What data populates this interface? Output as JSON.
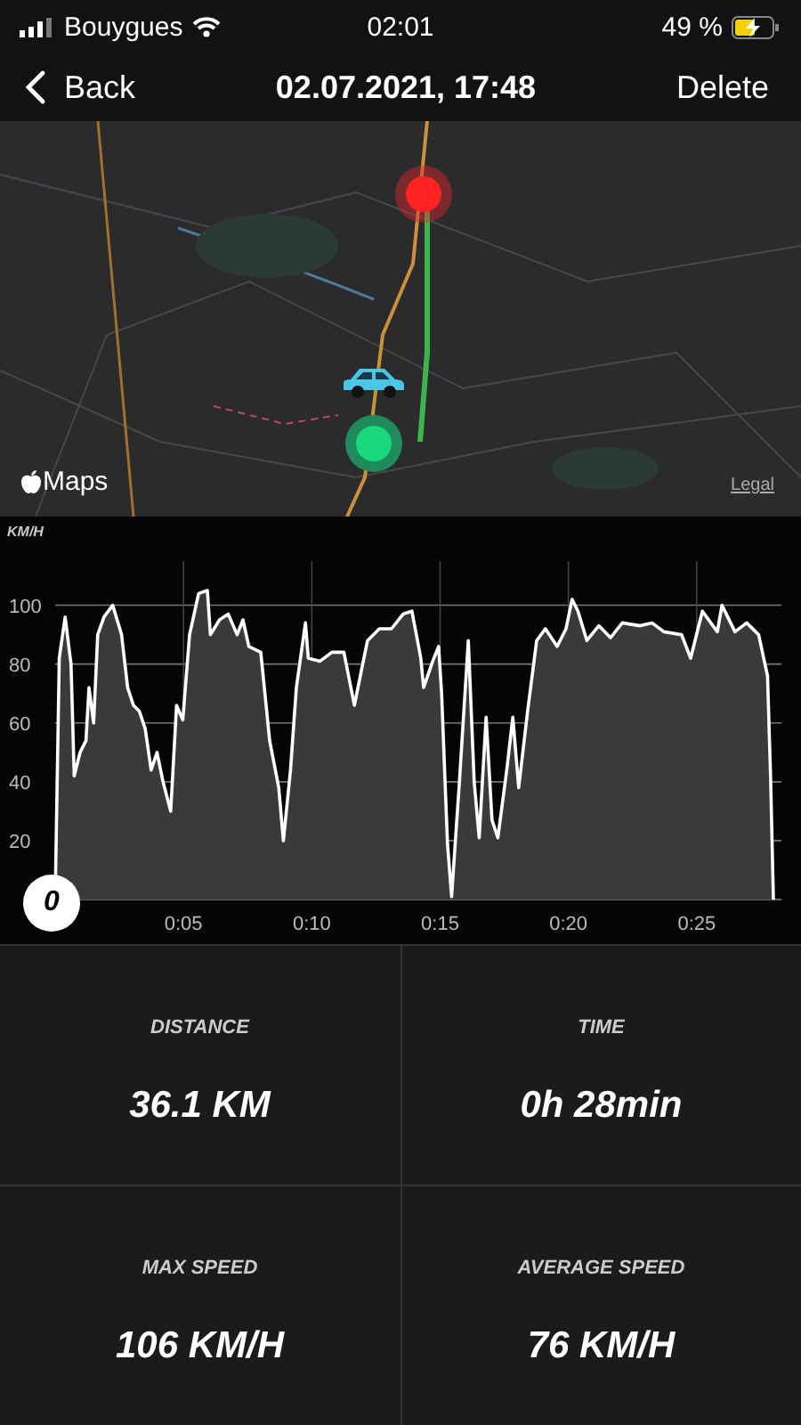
{
  "status_bar": {
    "carrier": "Bouygues",
    "time": "02:01",
    "battery": "49 %"
  },
  "nav": {
    "back": "Back",
    "title": "02.07.2021, 17:48",
    "action": "Delete"
  },
  "map": {
    "logo": "Maps",
    "legal": "Legal"
  },
  "speed_chart": {
    "zero_label": "0",
    "chart_data": {
      "type": "area",
      "ylabel": "KM/H",
      "grid": true,
      "xlim": [
        0,
        28.3
      ],
      "ylim": [
        0,
        115
      ],
      "xticks": [
        {
          "value": 5,
          "label": "0:05"
        },
        {
          "value": 10,
          "label": "0:10"
        },
        {
          "value": 15,
          "label": "0:15"
        },
        {
          "value": 20,
          "label": "0:20"
        },
        {
          "value": 25,
          "label": "0:25"
        }
      ],
      "yticks": [
        20,
        40,
        60,
        80,
        100
      ],
      "x": [
        0,
        0.16,
        0.39,
        0.62,
        0.74,
        0.97,
        1.2,
        1.32,
        1.5,
        1.66,
        1.9,
        2.24,
        2.59,
        2.82,
        3.05,
        3.28,
        3.51,
        3.74,
        3.97,
        4.2,
        4.5,
        4.73,
        4.97,
        5.24,
        5.59,
        5.93,
        6.05,
        6.4,
        6.74,
        7.09,
        7.32,
        7.55,
        8.01,
        8.36,
        8.71,
        8.89,
        9.17,
        9.4,
        9.75,
        9.86,
        10.32,
        10.78,
        11.25,
        11.66,
        11.94,
        12.17,
        12.63,
        13.1,
        13.56,
        13.9,
        14.25,
        14.36,
        14.71,
        14.94,
        15.06,
        15.29,
        15.45,
        15.75,
        16.1,
        16.33,
        16.52,
        16.79,
        17.02,
        17.25,
        17.6,
        17.83,
        18.06,
        18.41,
        18.76,
        19.1,
        19.56,
        19.91,
        20.14,
        20.37,
        20.72,
        21.18,
        21.64,
        22.1,
        22.79,
        23.26,
        23.72,
        24.41,
        24.76,
        25.22,
        25.8,
        25.98,
        26.49,
        26.95,
        27.41,
        27.76,
        27.88,
        27.99
      ],
      "series": [
        {
          "color": "#ffffff",
          "values": [
            0,
            82,
            96,
            80,
            42,
            50,
            54,
            72,
            60,
            90,
            96,
            100,
            90,
            72,
            66,
            64,
            58,
            44,
            50,
            40,
            30,
            66,
            61,
            90,
            104,
            105,
            90,
            95,
            97,
            90,
            95,
            86,
            84,
            54,
            38,
            20,
            44,
            72,
            94,
            82,
            81,
            84,
            84,
            66,
            78,
            88,
            92,
            92,
            97,
            98,
            82,
            72,
            81,
            86,
            70,
            19,
            1,
            40,
            88,
            40,
            21,
            62,
            27,
            21,
            44,
            62,
            38,
            64,
            88,
            92,
            86,
            92,
            102,
            98,
            88,
            93,
            89,
            94,
            93,
            94,
            91,
            90,
            82,
            98,
            91,
            100,
            91,
            94,
            90,
            76,
            42,
            0
          ]
        }
      ]
    }
  },
  "stats": [
    {
      "label": "DISTANCE",
      "value": "36.1 KM"
    },
    {
      "label": "TIME",
      "value": "0h 28min"
    },
    {
      "label": "MAX SPEED",
      "value": "106 KM/H"
    },
    {
      "label": "AVERAGE SPEED",
      "value": "76 KM/H"
    }
  ]
}
